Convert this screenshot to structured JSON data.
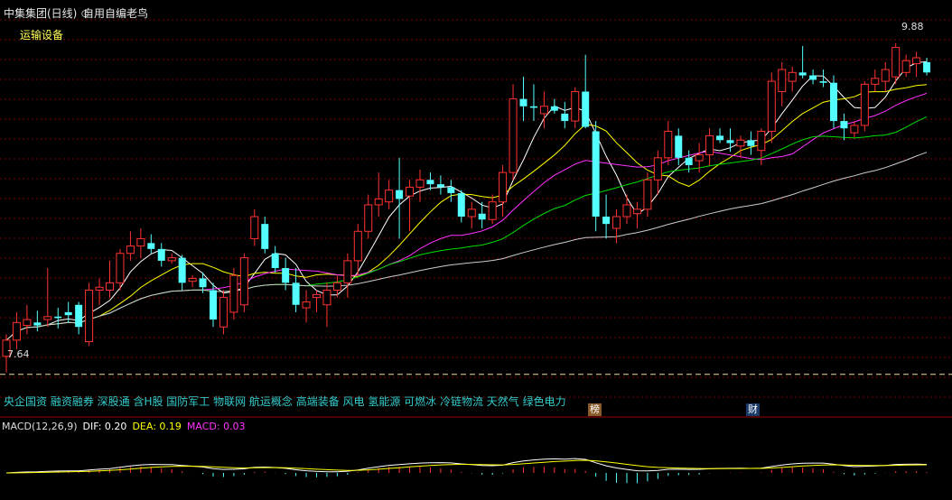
{
  "header": {
    "stock_title": "中集集团(日线)",
    "formula_name": "自用自编老鸟",
    "sector": "运输设备",
    "high_label": "9.88",
    "low_label": "7.64"
  },
  "concepts": "央企国资 融资融券 深股通 含H股 国防军工 物联网 航运概念 高端装备 风电 氢能源 可燃冰 冷链物流 天然气 绿色电力",
  "badges": {
    "a": "榜",
    "b": "财"
  },
  "macd": {
    "name": "MACD(12,26,9)",
    "dif": "DIF: 0.20",
    "dea": "DEA: 0.19",
    "macd": "MACD: 0.03"
  },
  "colors": {
    "up": "#ff3232",
    "down": "#54ffff",
    "ma5": "#ffffff",
    "ma10": "#ffff00",
    "ma20": "#ff33ff",
    "ma30": "#00dd00",
    "ma60": "#cccccc",
    "grid": "#7a0000"
  },
  "chart_data": {
    "type": "candlestick",
    "candles": [
      [
        7.75,
        7.9,
        7.64,
        7.86
      ],
      [
        7.86,
        8.05,
        7.8,
        7.98
      ],
      [
        7.96,
        8.1,
        7.9,
        8.0
      ],
      [
        7.98,
        8.06,
        7.92,
        7.96
      ],
      [
        8.0,
        8.35,
        7.95,
        8.02
      ],
      [
        8.02,
        8.08,
        7.94,
        8.01
      ],
      [
        8.05,
        8.12,
        7.98,
        8.03
      ],
      [
        8.1,
        8.12,
        7.9,
        7.95
      ],
      [
        7.85,
        8.25,
        7.82,
        8.2
      ],
      [
        8.2,
        8.28,
        8.1,
        8.22
      ],
      [
        8.2,
        8.4,
        8.15,
        8.25
      ],
      [
        8.25,
        8.48,
        8.2,
        8.45
      ],
      [
        8.45,
        8.6,
        8.4,
        8.5
      ],
      [
        8.5,
        8.62,
        8.42,
        8.55
      ],
      [
        8.52,
        8.58,
        8.45,
        8.48
      ],
      [
        8.48,
        8.52,
        8.36,
        8.4
      ],
      [
        8.4,
        8.45,
        8.38,
        8.42
      ],
      [
        8.42,
        8.44,
        8.2,
        8.25
      ],
      [
        8.26,
        8.3,
        8.22,
        8.28
      ],
      [
        8.28,
        8.32,
        8.18,
        8.22
      ],
      [
        8.2,
        8.25,
        7.95,
        8.0
      ],
      [
        7.95,
        8.2,
        7.9,
        8.15
      ],
      [
        8.05,
        8.35,
        8.0,
        8.3
      ],
      [
        8.1,
        8.45,
        8.05,
        8.42
      ],
      [
        8.55,
        8.75,
        8.5,
        8.7
      ],
      [
        8.65,
        8.7,
        8.45,
        8.48
      ],
      [
        8.45,
        8.5,
        8.32,
        8.35
      ],
      [
        8.35,
        8.42,
        8.2,
        8.25
      ],
      [
        8.25,
        8.35,
        8.05,
        8.1
      ],
      [
        8.08,
        8.2,
        7.98,
        8.12
      ],
      [
        8.15,
        8.2,
        8.05,
        8.17
      ],
      [
        8.1,
        8.25,
        7.95,
        8.2
      ],
      [
        8.2,
        8.3,
        8.15,
        8.25
      ],
      [
        8.25,
        8.45,
        8.15,
        8.4
      ],
      [
        8.4,
        8.65,
        8.3,
        8.6
      ],
      [
        8.6,
        8.85,
        8.55,
        8.78
      ],
      [
        8.78,
        9.0,
        8.7,
        8.82
      ],
      [
        8.8,
        8.95,
        8.75,
        8.88
      ],
      [
        8.88,
        9.1,
        8.55,
        8.82
      ],
      [
        8.84,
        8.95,
        8.6,
        8.9
      ],
      [
        8.9,
        9.02,
        8.8,
        8.95
      ],
      [
        8.95,
        9.0,
        8.88,
        8.92
      ],
      [
        8.92,
        8.98,
        8.85,
        8.9
      ],
      [
        8.9,
        8.95,
        8.8,
        8.86
      ],
      [
        8.86,
        8.88,
        8.66,
        8.7
      ],
      [
        8.7,
        8.8,
        8.62,
        8.75
      ],
      [
        8.72,
        8.8,
        8.62,
        8.68
      ],
      [
        8.68,
        8.85,
        8.65,
        8.8
      ],
      [
        8.8,
        9.05,
        8.7,
        9.0
      ],
      [
        9.0,
        9.6,
        8.95,
        9.5
      ],
      [
        9.5,
        9.65,
        9.35,
        9.45
      ],
      [
        9.45,
        9.6,
        9.35,
        9.44
      ],
      [
        9.4,
        9.55,
        9.3,
        9.45
      ],
      [
        9.45,
        9.5,
        9.4,
        9.42
      ],
      [
        9.4,
        9.48,
        9.3,
        9.35
      ],
      [
        9.35,
        9.58,
        9.3,
        9.55
      ],
      [
        9.55,
        9.8,
        9.3,
        9.31
      ],
      [
        9.28,
        9.35,
        8.6,
        8.7
      ],
      [
        8.7,
        8.85,
        8.55,
        8.65
      ],
      [
        8.62,
        8.75,
        8.52,
        8.7
      ],
      [
        8.7,
        8.85,
        8.65,
        8.78
      ],
      [
        8.72,
        8.8,
        8.62,
        8.75
      ],
      [
        8.75,
        9.0,
        8.7,
        8.95
      ],
      [
        8.95,
        9.15,
        8.85,
        9.1
      ],
      [
        9.1,
        9.35,
        9.05,
        9.28
      ],
      [
        9.25,
        9.3,
        9.05,
        9.1
      ],
      [
        9.1,
        9.15,
        9.0,
        9.05
      ],
      [
        9.08,
        9.2,
        9.0,
        9.12
      ],
      [
        9.12,
        9.3,
        9.05,
        9.25
      ],
      [
        9.25,
        9.3,
        9.2,
        9.22
      ],
      [
        9.22,
        9.3,
        9.14,
        9.2
      ],
      [
        9.18,
        9.25,
        9.1,
        9.22
      ],
      [
        9.22,
        9.28,
        9.12,
        9.18
      ],
      [
        9.15,
        9.3,
        9.05,
        9.28
      ],
      [
        9.28,
        9.68,
        9.2,
        9.62
      ],
      [
        9.55,
        9.75,
        9.45,
        9.7
      ],
      [
        9.62,
        9.72,
        9.55,
        9.68
      ],
      [
        9.68,
        9.86,
        9.64,
        9.66
      ],
      [
        9.66,
        9.7,
        9.6,
        9.63
      ],
      [
        9.62,
        9.7,
        9.58,
        9.61
      ],
      [
        9.61,
        9.66,
        9.3,
        9.35
      ],
      [
        9.35,
        9.4,
        9.22,
        9.3
      ],
      [
        9.27,
        9.35,
        9.24,
        9.32
      ],
      [
        9.32,
        9.62,
        9.28,
        9.6
      ],
      [
        9.6,
        9.7,
        9.55,
        9.64
      ],
      [
        9.62,
        9.75,
        9.55,
        9.7
      ],
      [
        9.65,
        9.88,
        9.6,
        9.85
      ],
      [
        9.68,
        9.8,
        9.65,
        9.76
      ],
      [
        9.74,
        9.82,
        9.65,
        9.78
      ],
      [
        9.75,
        9.78,
        9.66,
        9.68
      ]
    ]
  }
}
